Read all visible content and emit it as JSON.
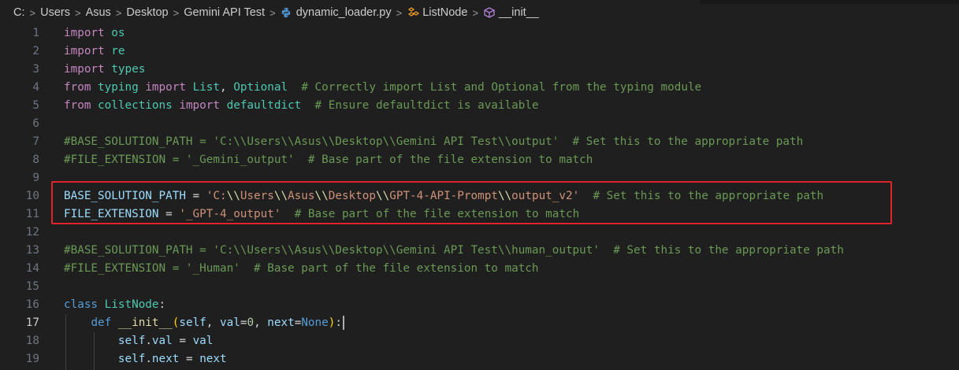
{
  "breadcrumb": {
    "items": [
      "C:",
      "Users",
      "Asus",
      "Desktop",
      "Gemini API Test",
      "dynamic_loader.py",
      "ListNode",
      "__init__"
    ],
    "separator": ">"
  },
  "editor": {
    "active_line": "17",
    "lines": [
      {
        "n": "1",
        "tokens": [
          [
            "kw",
            "import"
          ],
          [
            "op",
            " "
          ],
          [
            "mod",
            "os"
          ]
        ]
      },
      {
        "n": "2",
        "tokens": [
          [
            "kw",
            "import"
          ],
          [
            "op",
            " "
          ],
          [
            "mod",
            "re"
          ]
        ]
      },
      {
        "n": "3",
        "tokens": [
          [
            "kw",
            "import"
          ],
          [
            "op",
            " "
          ],
          [
            "mod",
            "types"
          ]
        ]
      },
      {
        "n": "4",
        "tokens": [
          [
            "kw",
            "from"
          ],
          [
            "op",
            " "
          ],
          [
            "mod",
            "typing"
          ],
          [
            "op",
            " "
          ],
          [
            "kw",
            "import"
          ],
          [
            "op",
            " "
          ],
          [
            "mod",
            "List"
          ],
          [
            "op",
            ", "
          ],
          [
            "mod",
            "Optional"
          ],
          [
            "op",
            "  "
          ],
          [
            "cm",
            "# Correctly import List and Optional from the typing module"
          ]
        ]
      },
      {
        "n": "5",
        "tokens": [
          [
            "kw",
            "from"
          ],
          [
            "op",
            " "
          ],
          [
            "mod",
            "collections"
          ],
          [
            "op",
            " "
          ],
          [
            "kw",
            "import"
          ],
          [
            "op",
            " "
          ],
          [
            "mod",
            "defaultdict"
          ],
          [
            "op",
            "  "
          ],
          [
            "cm",
            "# Ensure defaultdict is available"
          ]
        ]
      },
      {
        "n": "6",
        "tokens": []
      },
      {
        "n": "7",
        "tokens": [
          [
            "cm",
            "#BASE_SOLUTION_PATH = 'C:\\\\Users\\\\Asus\\\\Desktop\\\\Gemini API Test\\\\output'  # Set this to the appropriate path"
          ]
        ]
      },
      {
        "n": "8",
        "tokens": [
          [
            "cm",
            "#FILE_EXTENSION = '_Gemini_output'  # Base part of the file extension to match"
          ]
        ]
      },
      {
        "n": "9",
        "tokens": []
      },
      {
        "n": "10",
        "tokens": [
          [
            "var",
            "BASE_SOLUTION_PATH"
          ],
          [
            "op",
            " = "
          ],
          [
            "str",
            "'C:"
          ],
          [
            "fn",
            "\\\\"
          ],
          [
            "str",
            "Users"
          ],
          [
            "fn",
            "\\\\"
          ],
          [
            "str",
            "Asus"
          ],
          [
            "fn",
            "\\\\"
          ],
          [
            "str",
            "Desktop"
          ],
          [
            "fn",
            "\\\\"
          ],
          [
            "str",
            "GPT-4-API-Prompt"
          ],
          [
            "fn",
            "\\\\"
          ],
          [
            "str",
            "output_v2'"
          ],
          [
            "op",
            "  "
          ],
          [
            "cm",
            "# Set this to the appropriate path"
          ]
        ]
      },
      {
        "n": "11",
        "tokens": [
          [
            "var",
            "FILE_EXTENSION"
          ],
          [
            "op",
            " = "
          ],
          [
            "str",
            "'_GPT-4_output'"
          ],
          [
            "op",
            "  "
          ],
          [
            "cm",
            "# Base part of the file extension to match"
          ]
        ]
      },
      {
        "n": "12",
        "tokens": []
      },
      {
        "n": "13",
        "tokens": [
          [
            "cm",
            "#BASE_SOLUTION_PATH = 'C:\\\\Users\\\\Asus\\\\Desktop\\\\Gemini API Test\\\\human_output'  # Set this to the appropriate path"
          ]
        ]
      },
      {
        "n": "14",
        "tokens": [
          [
            "cm",
            "#FILE_EXTENSION = '_Human'  # Base part of the file extension to match"
          ]
        ]
      },
      {
        "n": "15",
        "tokens": []
      },
      {
        "n": "16",
        "tokens": [
          [
            "kw2",
            "class"
          ],
          [
            "op",
            " "
          ],
          [
            "mod",
            "ListNode"
          ],
          [
            "op",
            ":"
          ]
        ]
      },
      {
        "n": "17",
        "tokens": [
          [
            "op",
            "    "
          ],
          [
            "kw2",
            "def"
          ],
          [
            "op",
            " "
          ],
          [
            "fn",
            "__init__"
          ],
          [
            "br1",
            "("
          ],
          [
            "var",
            "self"
          ],
          [
            "op",
            ", "
          ],
          [
            "var",
            "val"
          ],
          [
            "op",
            "="
          ],
          [
            "num",
            "0"
          ],
          [
            "op",
            ", "
          ],
          [
            "var",
            "next"
          ],
          [
            "op",
            "="
          ],
          [
            "kw2",
            "None"
          ],
          [
            "br1",
            ")"
          ],
          [
            "op",
            ":"
          ]
        ]
      },
      {
        "n": "18",
        "tokens": [
          [
            "op",
            "        "
          ],
          [
            "var",
            "self"
          ],
          [
            "op",
            "."
          ],
          [
            "var",
            "val"
          ],
          [
            "op",
            " = "
          ],
          [
            "var",
            "val"
          ]
        ]
      },
      {
        "n": "19",
        "tokens": [
          [
            "op",
            "        "
          ],
          [
            "var",
            "self"
          ],
          [
            "op",
            "."
          ],
          [
            "var",
            "next"
          ],
          [
            "op",
            " = "
          ],
          [
            "var",
            "next"
          ]
        ]
      }
    ]
  },
  "colors": {
    "background": "#1f1f1f",
    "highlight_border": "#e0242a",
    "keyword": "#c586c0",
    "comment": "#6a9955",
    "string": "#ce9178"
  }
}
